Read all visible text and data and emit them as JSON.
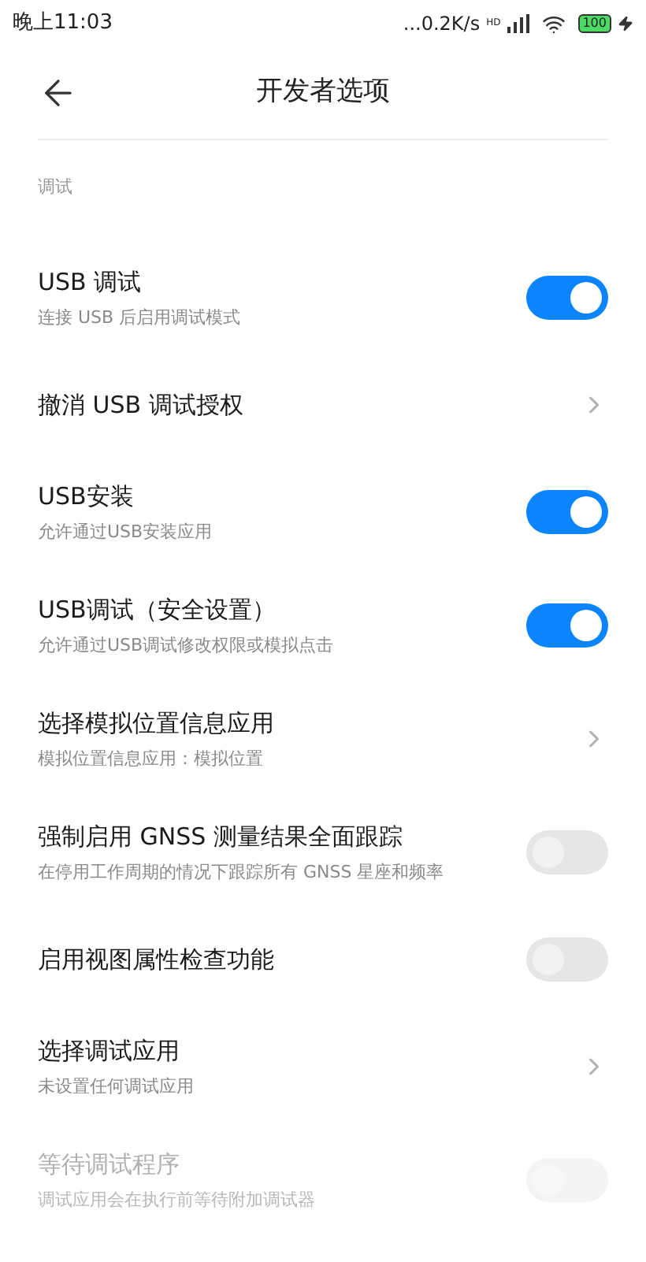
{
  "status_bar": {
    "time": "晚上11:03",
    "speed": "...0.2K/s",
    "network": "HD",
    "battery": "100"
  },
  "header": {
    "title": "开发者选项"
  },
  "section": "调试",
  "rows": [
    {
      "kind": "toggle",
      "title": "USB 调试",
      "subtitle": "连接 USB 后启用调试模式",
      "on": true,
      "disabled": false
    },
    {
      "kind": "link",
      "title": "撤消 USB 调试授权",
      "disabled": false
    },
    {
      "kind": "toggle",
      "title": "USB安装",
      "subtitle": "允许通过USB安装应用",
      "on": true,
      "disabled": false
    },
    {
      "kind": "toggle",
      "title": "USB调试（安全设置）",
      "subtitle": "允许通过USB调试修改权限或模拟点击",
      "on": true,
      "disabled": false
    },
    {
      "kind": "link",
      "title": "选择模拟位置信息应用",
      "subtitle": "模拟位置信息应用：模拟位置",
      "disabled": false
    },
    {
      "kind": "toggle",
      "title": "强制启用 GNSS 测量结果全面跟踪",
      "subtitle": "在停用工作周期的情况下跟踪所有 GNSS 星座和频率",
      "on": false,
      "disabled": false
    },
    {
      "kind": "toggle",
      "title": "启用视图属性检查功能",
      "on": false,
      "disabled": false
    },
    {
      "kind": "link",
      "title": "选择调试应用",
      "subtitle": "未设置任何调试应用",
      "disabled": false
    },
    {
      "kind": "toggle",
      "title": "等待调试程序",
      "subtitle": "调试应用会在执行前等待附加调试器",
      "on": false,
      "disabled": true
    }
  ]
}
